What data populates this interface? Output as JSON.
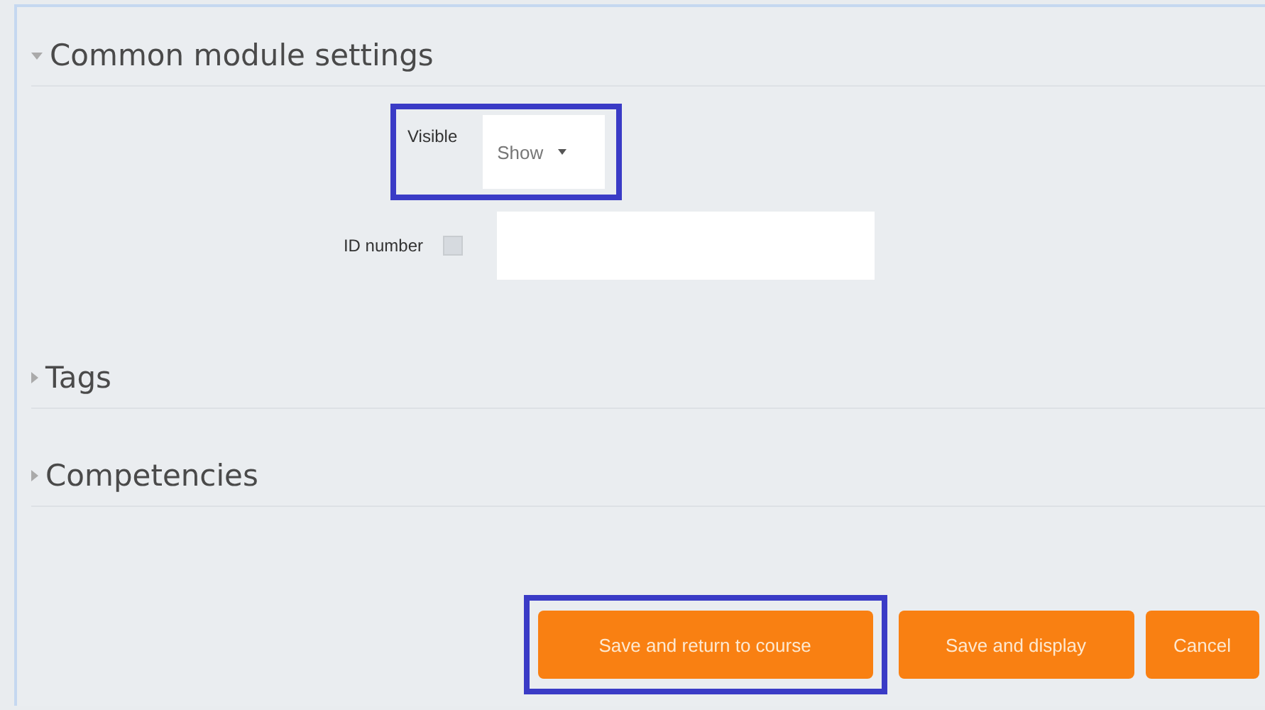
{
  "sections": [
    {
      "title": "Common module settings",
      "expanded": true,
      "fields": [
        {
          "kind": "select",
          "label": "Visible",
          "value": "Show",
          "help": false,
          "highlighted": true
        },
        {
          "kind": "text",
          "label": "ID number",
          "help": true,
          "highlighted": false
        }
      ]
    },
    {
      "title": "Tags",
      "expanded": false
    },
    {
      "title": "Competencies",
      "expanded": false
    }
  ],
  "buttons": [
    {
      "label": "Save and return to course",
      "highlighted": true
    },
    {
      "label": "Save and display",
      "highlighted": false
    },
    {
      "label": "Cancel",
      "highlighted": false
    }
  ]
}
